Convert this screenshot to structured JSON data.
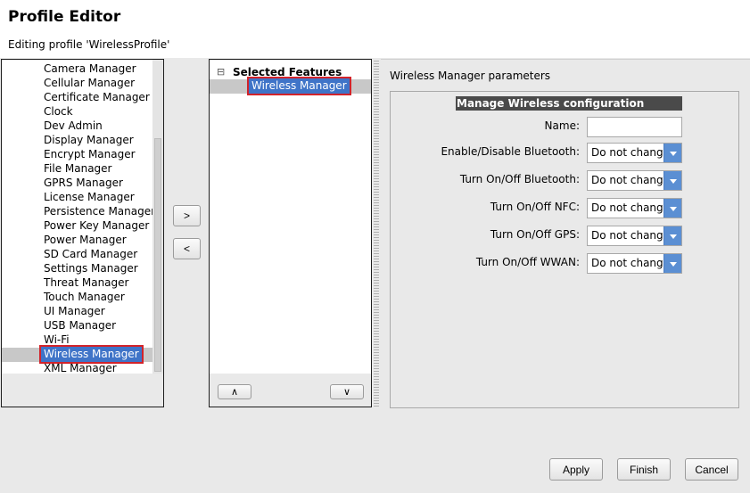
{
  "header": {
    "title": "Profile Editor",
    "subtitle": "Editing profile 'WirelessProfile'"
  },
  "available_features": [
    "Camera Manager",
    "Cellular Manager",
    "Certificate Manager",
    "Clock",
    "Dev Admin",
    "Display Manager",
    "Encrypt Manager",
    "File Manager",
    "GPRS Manager",
    "License Manager",
    "Persistence Manager",
    "Power Key Manager",
    "Power Manager",
    "SD Card Manager",
    "Settings Manager",
    "Threat Manager",
    "Touch Manager",
    "UI Manager",
    "USB Manager",
    "Wi-Fi",
    "Wireless Manager",
    "XML Manager"
  ],
  "selected_available": "Wireless Manager",
  "transfer": {
    "add_label": ">",
    "remove_label": "<"
  },
  "selected_features": {
    "header": "Selected Features",
    "collapse_glyph": "⊟",
    "items": [
      "Wireless Manager"
    ],
    "up_label": "∧",
    "down_label": "∨"
  },
  "params": {
    "panel_title": "Wireless Manager parameters",
    "section_title": "Manage Wireless configuration",
    "name_label": "Name:",
    "name_value": "",
    "rows": [
      {
        "label": "Enable/Disable Bluetooth:",
        "value": "Do not change"
      },
      {
        "label": "Turn On/Off Bluetooth:",
        "value": "Do not change"
      },
      {
        "label": "Turn On/Off NFC:",
        "value": "Do not change"
      },
      {
        "label": "Turn On/Off GPS:",
        "value": "Do not change"
      },
      {
        "label": "Turn On/Off WWAN:",
        "value": "Do not change"
      }
    ]
  },
  "footer": {
    "apply": "Apply",
    "finish": "Finish",
    "cancel": "Cancel"
  },
  "colors": {
    "selection": "#3f74c8",
    "highlight_border": "#d2232a",
    "dropdown_arrow": "#5b8fd3"
  }
}
